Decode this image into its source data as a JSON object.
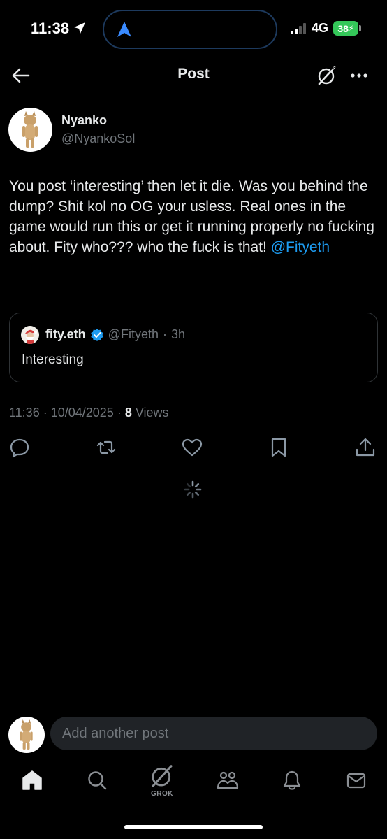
{
  "status_bar": {
    "time": "11:38",
    "network": "4G",
    "battery": "38"
  },
  "header": {
    "title": "Post"
  },
  "post": {
    "author_name": "Nyanko",
    "author_handle": "@NyankoSol",
    "text": "You post ‘interesting’ then let it die. Was you behind the dump? Shit kol no OG your usless. Real ones in the game would run this or get it running properly no fucking about. Fity who??? who the fuck is that! ",
    "mention": "@Fityeth",
    "time": "11:36",
    "date": "10/04/2025",
    "views_count": "8",
    "views_label": "Views"
  },
  "quote": {
    "author_name": "fity.eth",
    "author_handle": "@Fityeth",
    "age": "3h",
    "text": "Interesting"
  },
  "composer": {
    "placeholder": "Add another post"
  },
  "bottom_nav": {
    "grok_label": "GROK",
    "items": [
      "home-icon",
      "search-icon",
      "grok-icon",
      "communities-icon",
      "notifications-icon",
      "messages-icon"
    ]
  },
  "colors": {
    "background": "#000000",
    "text": "#e7e9ea",
    "muted": "#71767b",
    "accent": "#1d9bf0",
    "battery": "#34c759"
  }
}
